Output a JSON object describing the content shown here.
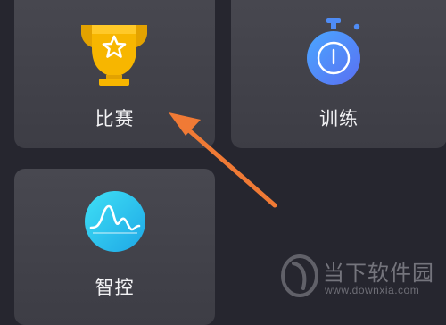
{
  "tiles": {
    "match": {
      "label": "比赛",
      "icon": "trophy-icon"
    },
    "training": {
      "label": "训练",
      "icon": "stopwatch-icon"
    },
    "smart": {
      "label": "智控",
      "icon": "waveform-icon"
    }
  },
  "annotation": {
    "icon": "arrow-pointer-icon",
    "color": "#f07a35"
  },
  "watermark": {
    "title": "当下软件园",
    "url": "www.downxia.com",
    "icon": "downxia-logo-icon"
  },
  "colors": {
    "background": "#26262f",
    "card": "#45454d",
    "trophy": "#f5b400",
    "stopwatch": "#4f84f5",
    "waveform": "#2ec7ee"
  }
}
